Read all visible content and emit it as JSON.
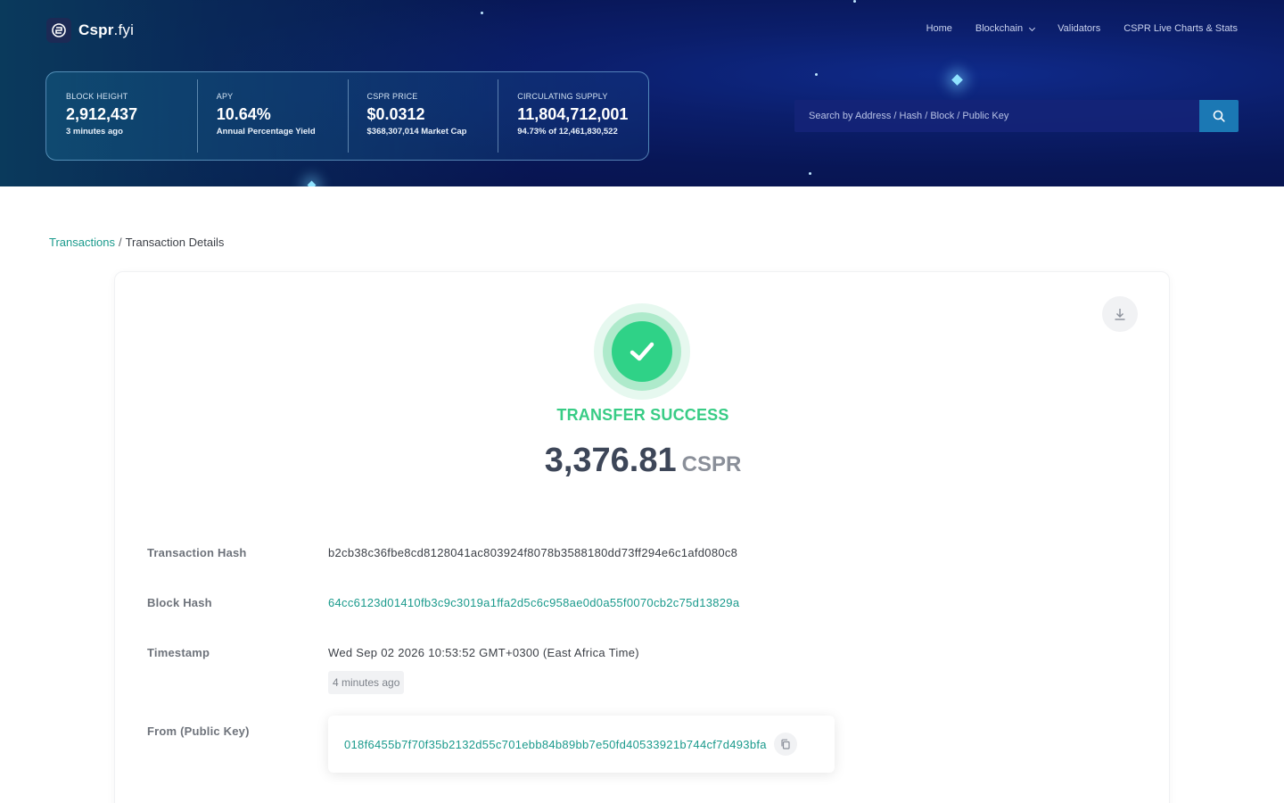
{
  "brand": {
    "name_main": "Cspr",
    "name_suffix": ".fyi"
  },
  "nav": {
    "items": [
      {
        "label": "Home"
      },
      {
        "label": "Blockchain"
      },
      {
        "label": "Validators"
      },
      {
        "label": "CSPR Live Charts & Stats"
      }
    ]
  },
  "stats": {
    "block_height": {
      "label": "BLOCK HEIGHT",
      "value": "2,912,437",
      "sub": "3 minutes ago"
    },
    "apy": {
      "label": "APY",
      "value": "10.64%",
      "sub": "Annual Percentage Yield"
    },
    "price": {
      "label": "CSPR PRICE",
      "value": "$0.0312",
      "sub": "$368,307,014 Market Cap"
    },
    "supply": {
      "label": "CIRCULATING SUPPLY",
      "value": "11,804,712,001",
      "sub": "94.73% of 12,461,830,522"
    }
  },
  "search": {
    "placeholder": "Search by Address / Hash / Block / Public Key"
  },
  "breadcrumb": {
    "parent": "Transactions",
    "separator": "/",
    "current": "Transaction Details"
  },
  "transaction": {
    "status": "TRANSFER SUCCESS",
    "amount": "3,376.81",
    "unit": "CSPR",
    "fields": {
      "hash": {
        "label": "Transaction Hash",
        "value": "b2cb38c36fbe8cd8128041ac803924f8078b3588180dd73ff294e6c1afd080c8"
      },
      "block_hash": {
        "label": "Block Hash",
        "value": "64cc6123d01410fb3c9c3019a1ffa2d5c6c958ae0d0a55f0070cb2c75d13829a"
      },
      "timestamp": {
        "label": "Timestamp",
        "value": "Wed Sep 02 2026 10:53:52 GMT+0300 (East Africa Time)",
        "ago": "4 minutes ago"
      },
      "from": {
        "label": "From (Public Key)",
        "value": "018f6455b7f70f35b2132d55c701ebb84b89bb7e50fd40533921b744cf7d493bfa"
      }
    }
  },
  "colors": {
    "accent": "#1a9a8c",
    "success": "#38cc85",
    "header_bg": "#081656"
  },
  "icons": {
    "logo": "cspr-logo-icon",
    "search": "search-icon",
    "download": "download-icon",
    "success": "check-icon",
    "copy": "copy-icon"
  }
}
